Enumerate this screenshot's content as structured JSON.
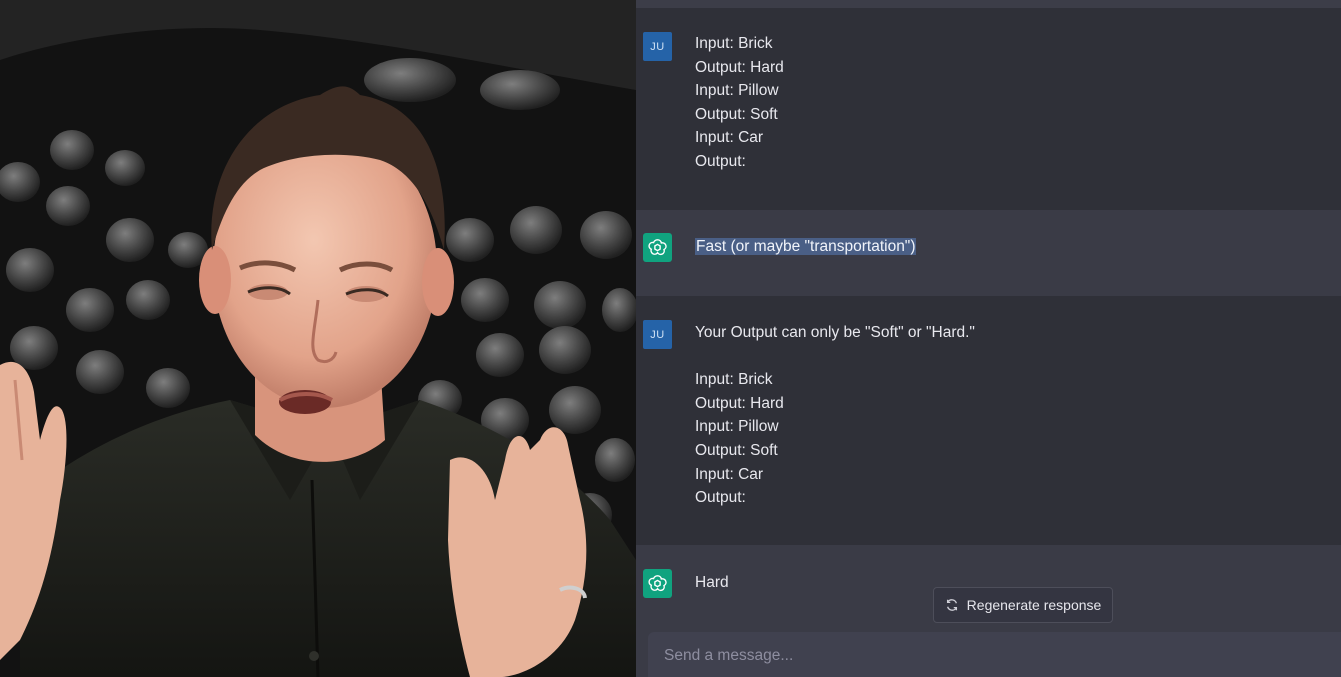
{
  "chat": {
    "messages": [
      {
        "role": "user",
        "avatar": "JU",
        "lines": [
          "Input: Brick",
          "Output: Hard",
          "Input: Pillow",
          "Output: Soft",
          "Input: Car",
          "Output:"
        ]
      },
      {
        "role": "assistant",
        "avatar_icon": "openai-logo-icon",
        "text": "Fast (or maybe \"transportation\")",
        "highlighted": true
      },
      {
        "role": "user",
        "avatar": "JU",
        "lines": [
          "Your Output can only be \"Soft\" or \"Hard.\"",
          "",
          "Input: Brick",
          "Output: Hard",
          "Input: Pillow",
          "Output: Soft",
          "Input: Car",
          "Output:"
        ]
      },
      {
        "role": "assistant",
        "avatar_icon": "openai-logo-icon",
        "text": "Hard"
      }
    ],
    "regenerate_label": "Regenerate response",
    "regenerate_icon": "refresh-icon",
    "input_placeholder": "Send a message..."
  },
  "colors": {
    "chat_bg": "#343541",
    "assistant_row_bg": "#3a3b46",
    "user_avatar": "#2563a8",
    "bot_avatar": "#10a37f",
    "selection_highlight": "#4a5f86"
  }
}
